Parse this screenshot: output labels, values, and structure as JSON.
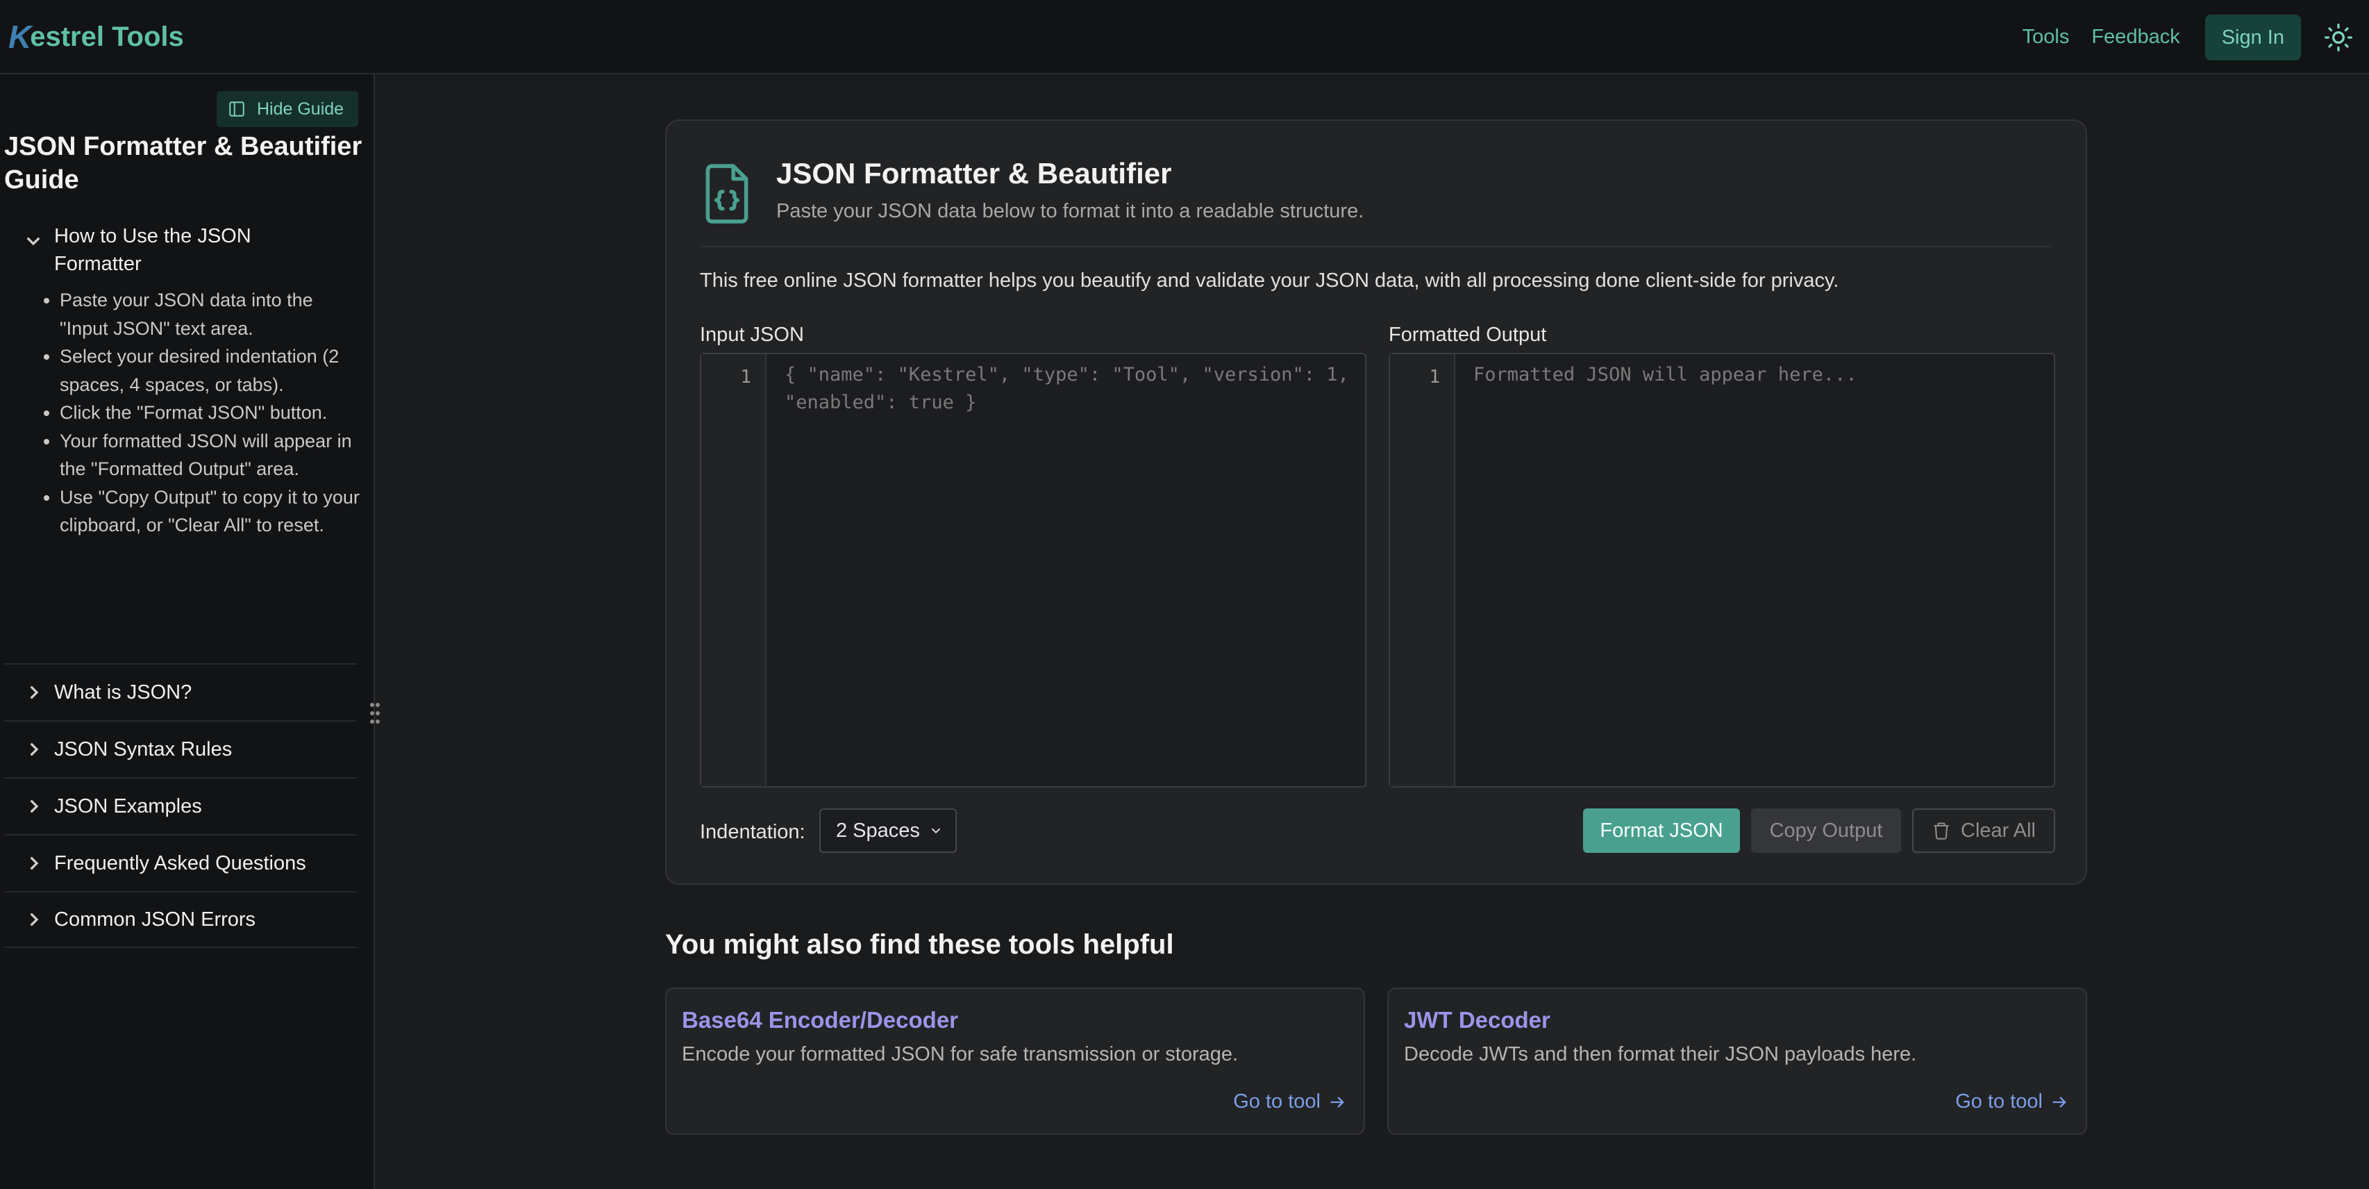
{
  "header": {
    "logo_mark": "K",
    "logo_text": "estrel Tools",
    "nav": [
      "Tools",
      "Feedback"
    ],
    "signin": "Sign In",
    "theme_icon": "sun-icon"
  },
  "sidebar": {
    "hide_guide": "Hide Guide",
    "title": "JSON Formatter & Beautifier Guide",
    "open_section": {
      "title": "How to Use the JSON Formatter",
      "steps": [
        "Paste your JSON data into the \"Input JSON\" text area.",
        "Select your desired indentation (2 spaces, 4 spaces, or tabs).",
        "Click the \"Format JSON\" button.",
        "Your formatted JSON will appear in the \"Formatted Output\" area.",
        "Use \"Copy Output\" to copy it to your clipboard, or \"Clear All\" to reset."
      ]
    },
    "sections": [
      "What is JSON?",
      "JSON Syntax Rules",
      "JSON Examples",
      "Frequently Asked Questions",
      "Common JSON Errors"
    ]
  },
  "main": {
    "icon": "file-json-icon",
    "title": "JSON Formatter & Beautifier",
    "subtitle": "Paste your JSON data below to format it into a readable structure.",
    "description": "This free online JSON formatter helps you beautify and validate your JSON data, with all processing done client-side for privacy.",
    "input": {
      "label": "Input JSON",
      "line_number": "1",
      "placeholder": "{ \"name\": \"Kestrel\", \"type\": \"Tool\", \"version\": 1, \"enabled\": true }"
    },
    "output": {
      "label": "Formatted Output",
      "line_number": "1",
      "placeholder": "Formatted JSON will appear here..."
    },
    "indentation_label": "Indentation:",
    "indentation_value": "2 Spaces",
    "buttons": {
      "format": "Format JSON",
      "copy": "Copy Output",
      "clear": "Clear All"
    }
  },
  "suggestions": {
    "title": "You might also find these tools helpful",
    "tools": [
      {
        "name": "Base64 Encoder/Decoder",
        "desc": "Encode your formatted JSON for safe transmission or storage.",
        "link": "Go to tool"
      },
      {
        "name": "JWT Decoder",
        "desc": "Decode JWTs and then format their JSON payloads here.",
        "link": "Go to tool"
      }
    ]
  },
  "colors": {
    "accent": "#4aa08e",
    "link_purple": "#9b94e8",
    "link_blue": "#7b9ee8",
    "background": "#1a1b1d"
  }
}
